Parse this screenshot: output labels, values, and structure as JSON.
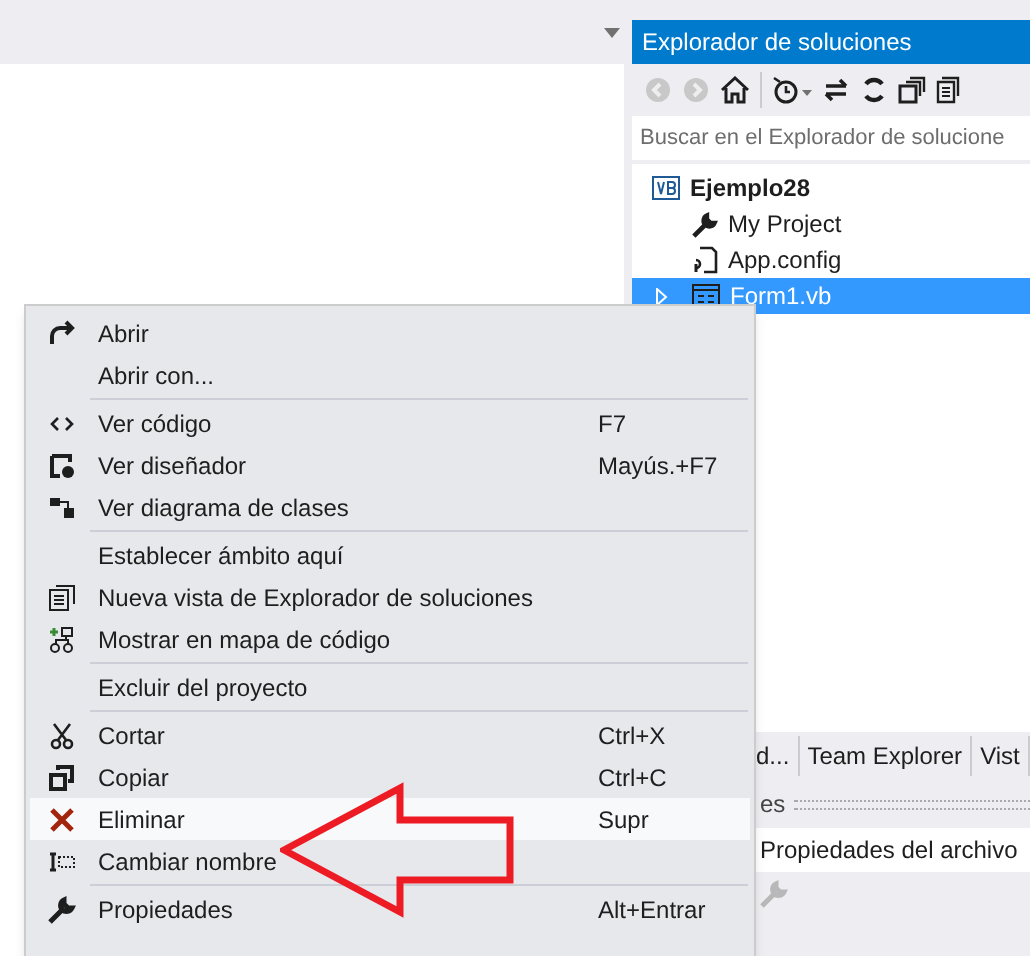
{
  "solution_explorer": {
    "title": "Explorador de soluciones",
    "search": {
      "placeholder": "Buscar en el Explorador de solucione"
    },
    "tree": [
      {
        "label": "Ejemplo28",
        "kind": "project",
        "selected": false
      },
      {
        "label": "My Project",
        "kind": "wrench",
        "selected": false
      },
      {
        "label": "App.config",
        "kind": "config",
        "selected": false
      },
      {
        "label": "Form1.vb",
        "kind": "form",
        "selected": true
      }
    ]
  },
  "bottom_tabs": [
    {
      "label": "d..."
    },
    {
      "label": "Team Explorer"
    },
    {
      "label": "Vist"
    }
  ],
  "properties": {
    "header": "es",
    "object": "Propiedades del archivo"
  },
  "context_menu": [
    {
      "kind": "item",
      "label": "Abrir",
      "selected": false
    },
    {
      "kind": "item",
      "label": "Abrir con...",
      "selected": false
    },
    {
      "kind": "separator"
    },
    {
      "kind": "item",
      "label": "Ver código",
      "shortcut": "F7",
      "selected": false
    },
    {
      "kind": "item",
      "label": "Ver diseñador",
      "shortcut": "Mayús.+F7",
      "selected": false
    },
    {
      "kind": "item",
      "label": "Ver diagrama de clases",
      "selected": false
    },
    {
      "kind": "separator"
    },
    {
      "kind": "item",
      "label": "Establecer ámbito aquí",
      "selected": false
    },
    {
      "kind": "item",
      "label": "Nueva vista de Explorador de soluciones",
      "selected": false
    },
    {
      "kind": "item",
      "label": "Mostrar en mapa de código",
      "selected": false
    },
    {
      "kind": "separator"
    },
    {
      "kind": "item",
      "label": "Excluir del proyecto",
      "selected": false
    },
    {
      "kind": "separator"
    },
    {
      "kind": "item",
      "label": "Cortar",
      "shortcut": "Ctrl+X",
      "selected": false
    },
    {
      "kind": "item",
      "label": "Copiar",
      "shortcut": "Ctrl+C",
      "selected": false
    },
    {
      "kind": "item",
      "label": "Eliminar",
      "shortcut": "Supr",
      "selected": true
    },
    {
      "kind": "item",
      "label": "Cambiar nombre",
      "selected": false
    },
    {
      "kind": "separator"
    },
    {
      "kind": "item",
      "label": "Propiedades",
      "shortcut": "Alt+Entrar",
      "selected": false
    }
  ]
}
